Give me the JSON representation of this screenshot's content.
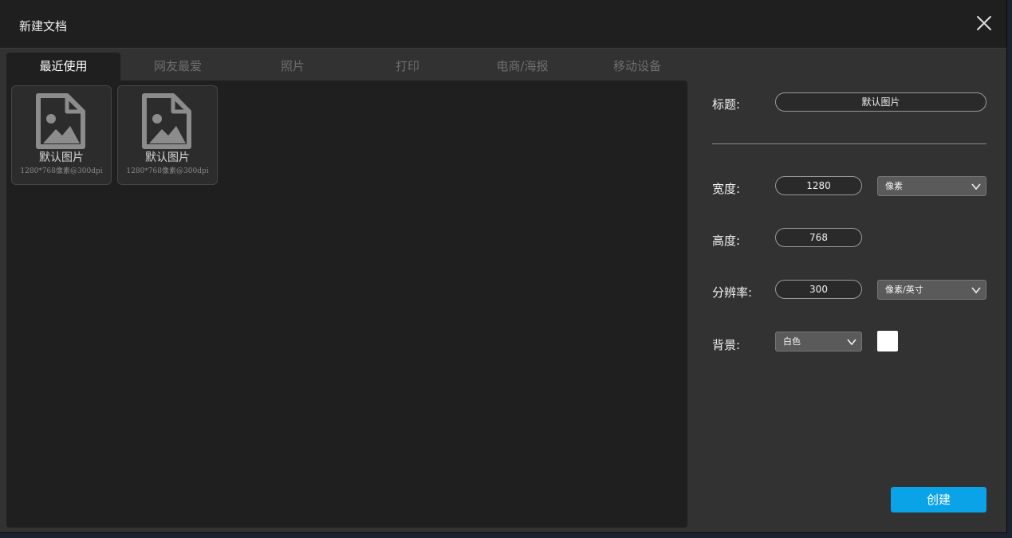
{
  "dialog": {
    "title": "新建文档"
  },
  "tabs": [
    "最近使用",
    "网友最爱",
    "照片",
    "打印",
    "电商/海报",
    "移动设备"
  ],
  "active_tab": "最近使用",
  "cards": [
    {
      "name": "默认图片",
      "desc": "1280*768像素@300dpi",
      "icon": "image-file-icon"
    },
    {
      "name": "默认图片",
      "desc": "1280*768像素@300dpi",
      "icon": "image-file-icon"
    }
  ],
  "form": {
    "title_label": "标题:",
    "title_value": "默认图片",
    "width_label": "宽度:",
    "width_value": "1280",
    "width_unit": "像素",
    "height_label": "高度:",
    "height_value": "768",
    "resolution_label": "分辨率:",
    "resolution_value": "300",
    "resolution_unit": "像素/英寸",
    "background_label": "背景:",
    "background_value": "白色",
    "background_color": "#ffffff"
  },
  "create_label": "创建",
  "colors": {
    "accent": "#0aa3e8",
    "panel": "#1f1f1f",
    "dialog": "#323232"
  }
}
